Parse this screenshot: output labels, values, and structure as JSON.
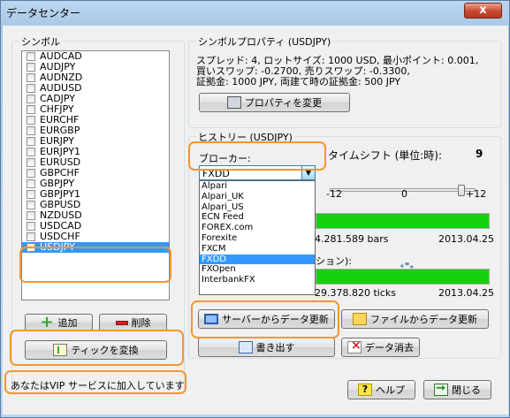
{
  "window": {
    "title": "データセンター",
    "close_glyph": "x"
  },
  "symbols": {
    "legend": "シンボル",
    "items": [
      {
        "label": "AUDCAD",
        "selected": false
      },
      {
        "label": "AUDJPY",
        "selected": false
      },
      {
        "label": "AUDNZD",
        "selected": false
      },
      {
        "label": "AUDUSD",
        "selected": false
      },
      {
        "label": "CADJPY",
        "selected": false
      },
      {
        "label": "CHFJPY",
        "selected": false
      },
      {
        "label": "EURCHF",
        "selected": false
      },
      {
        "label": "EURGBP",
        "selected": false
      },
      {
        "label": "EURJPY",
        "selected": false
      },
      {
        "label": "EURJPY1",
        "selected": false
      },
      {
        "label": "EURUSD",
        "selected": false
      },
      {
        "label": "GBPCHF",
        "selected": false
      },
      {
        "label": "GBPJPY",
        "selected": false
      },
      {
        "label": "GBPJPY1",
        "selected": false
      },
      {
        "label": "GBPUSD",
        "selected": false
      },
      {
        "label": "NZDUSD",
        "selected": false
      },
      {
        "label": "USDCAD",
        "selected": false
      },
      {
        "label": "USDCHF",
        "selected": false
      },
      {
        "label": "USDJPY",
        "selected": true
      }
    ],
    "add_label": "追加",
    "delete_label": "削除",
    "convert_ticks_label": "ティックを変換"
  },
  "vip_status": "あなたはVIP サービスに加入しています",
  "properties": {
    "legend": "シンボルプロパティ (USDJPY)",
    "lines": [
      "スプレッド: 4, ロットサイズ: 1000 USD, 最小ポイント: 0.001,",
      "買いスワップ: -0.2700, 売りスワップ: -0.3300,",
      "証拠金: 1000 JPY, 両建て時の証拠金: 500 JPY"
    ],
    "change_label": "プロパティを変更"
  },
  "history": {
    "legend": "ヒストリー (USDJPY)",
    "broker_label": "ブローカー:",
    "broker_value": "FXDD",
    "broker_options": [
      "Alpari",
      "Alpari_UK",
      "Alpari_US",
      "ECN Feed",
      "FOREX.com",
      "Forexite",
      "FXCM",
      "FXDD",
      "FXOpen",
      "InterbankFX"
    ],
    "broker_selected": "FXDD",
    "timeshift_label": "タイムシフト (単位:時):",
    "timeshift_value": "9",
    "scale": [
      "-12",
      "0",
      "+12"
    ],
    "bars_count": "4.281.589 bars",
    "bars_date": "2013.04.25",
    "ticks_label_fragment": "ション):",
    "ticks_count": "29.378.820 ticks",
    "ticks_date": "2013.04.25",
    "server_update_label": "サーバーからデータ更新",
    "file_update_label": "ファイルからデータ更新",
    "export_label": "書き出す",
    "erase_label": "データ消去"
  },
  "footer": {
    "help_label": "ヘルプ",
    "close_label": "閉じる"
  }
}
